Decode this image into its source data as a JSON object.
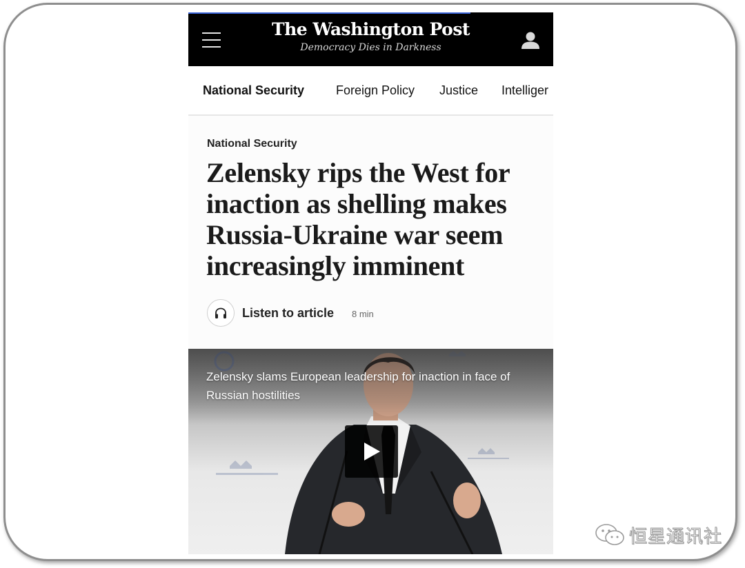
{
  "site": {
    "name": "The Washington Post",
    "tagline": "Democracy Dies in Darkness"
  },
  "icons": {
    "menu": "hamburger-menu-icon",
    "account": "user-icon",
    "listen": "headphones-icon",
    "play": "play-icon",
    "watermark": "wechat-icon"
  },
  "nav": {
    "tabs": [
      {
        "label": "National Security",
        "active": true
      },
      {
        "label": "Foreign Policy",
        "active": false
      },
      {
        "label": "Justice",
        "active": false
      },
      {
        "label": "Intelliger",
        "active": false
      }
    ]
  },
  "article": {
    "kicker": "National Security",
    "headline": "Zelensky rips the West for inaction as shelling makes Russia-Ukraine war seem increasingly imminent",
    "listen_label": "Listen to article",
    "listen_duration": "8 min"
  },
  "video": {
    "caption": "Zelensky slams European leadership for inaction in face of Russian hostilities",
    "backdrop_logo": "msc"
  },
  "watermark": {
    "text": "恒星通讯社"
  },
  "colors": {
    "header_bg": "#000000",
    "accent_progress": "#3a63d8",
    "text_primary": "#111111",
    "frame_border": "#8e8e8e"
  }
}
